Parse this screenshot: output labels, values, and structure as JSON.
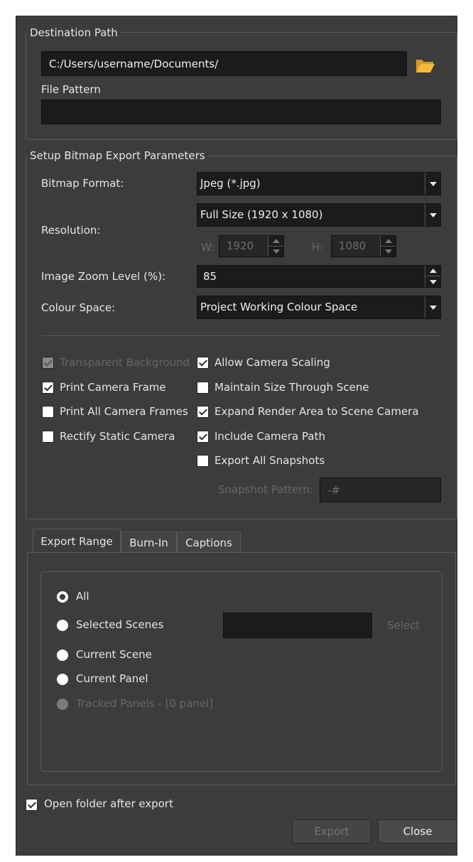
{
  "destination": {
    "group_title": "Destination Path",
    "path_value": "C:/Users/username/Documents/",
    "file_pattern_label": "File Pattern",
    "file_pattern_value": ""
  },
  "bitmap": {
    "group_title": "Setup Bitmap Export Parameters",
    "format_label": "Bitmap Format:",
    "format_value": "Jpeg (*.jpg)",
    "resolution_label": "Resolution:",
    "resolution_value": "Full Size (1920 x 1080)",
    "width_label": "W:",
    "width_value": "1920",
    "height_label": "H:",
    "height_value": "1080",
    "zoom_label": "Image Zoom Level (%):",
    "zoom_value": "85",
    "colour_label": "Colour Space:",
    "colour_value": "Project Working Colour Space",
    "options_left": [
      {
        "label": "Transparent Background",
        "checked": true,
        "enabled": false
      },
      {
        "label": "Print Camera Frame",
        "checked": true,
        "enabled": true
      },
      {
        "label": "Print All Camera Frames",
        "checked": false,
        "enabled": true
      },
      {
        "label": "Rectify Static Camera",
        "checked": false,
        "enabled": true
      }
    ],
    "options_right": [
      {
        "label": "Allow Camera Scaling",
        "checked": true,
        "enabled": true
      },
      {
        "label": "Maintain Size Through Scene",
        "checked": false,
        "enabled": true
      },
      {
        "label": "Expand Render Area to Scene Camera",
        "checked": true,
        "enabled": true
      },
      {
        "label": "Include Camera Path",
        "checked": true,
        "enabled": true
      },
      {
        "label": "Export All Snapshots",
        "checked": false,
        "enabled": true
      }
    ],
    "snapshot_label": "Snapshot Pattern:",
    "snapshot_value": "-#"
  },
  "tabs": [
    {
      "label": "Export Range",
      "active": true
    },
    {
      "label": "Burn-In",
      "active": false
    },
    {
      "label": "Captions",
      "active": false
    }
  ],
  "range": {
    "options": [
      {
        "label": "All",
        "selected": true,
        "enabled": true
      },
      {
        "label": "Selected Scenes",
        "selected": false,
        "enabled": true
      },
      {
        "label": "Current Scene",
        "selected": false,
        "enabled": true
      },
      {
        "label": "Current Panel",
        "selected": false,
        "enabled": true
      },
      {
        "label": "Tracked Panels - [0 panel]",
        "selected": false,
        "enabled": false
      }
    ],
    "selected_scenes_value": "",
    "select_button": "Select"
  },
  "footer": {
    "open_folder_label": "Open folder after export",
    "open_folder_checked": true,
    "export_button": "Export",
    "close_button": "Close"
  }
}
